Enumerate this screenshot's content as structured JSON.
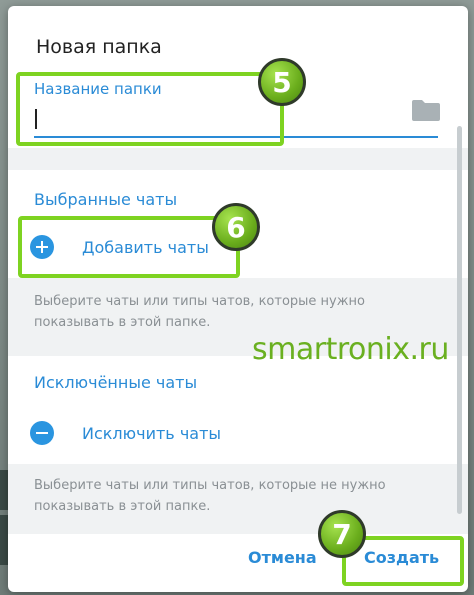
{
  "dialog": {
    "title": "Новая папка",
    "name_field": {
      "label": "Название папки",
      "value": "",
      "placeholder": ""
    },
    "included": {
      "header": "Выбранные чаты",
      "add_label": "Добавить чаты",
      "hint": "Выберите чаты или типы чатов, которые нужно показывать в этой папке."
    },
    "excluded": {
      "header": "Исключённые чаты",
      "exclude_label": "Исключить чаты",
      "hint": "Выберите чаты или типы чатов, которые не нужно показывать в этой папке."
    },
    "footer": {
      "cancel_label": "Отмена",
      "create_label": "Создать"
    }
  },
  "annotations": {
    "step_5": "5",
    "step_6": "6",
    "step_7": "7"
  },
  "watermark": "smartronix.ru",
  "colors": {
    "accent": "#2a8bd6",
    "highlight": "#7ed321",
    "hint_text": "#8a9094",
    "section_bg": "#f0f2f3"
  },
  "icons": {
    "folder": "folder-icon",
    "add": "plus-circle-icon",
    "exclude": "minus-circle-icon"
  }
}
